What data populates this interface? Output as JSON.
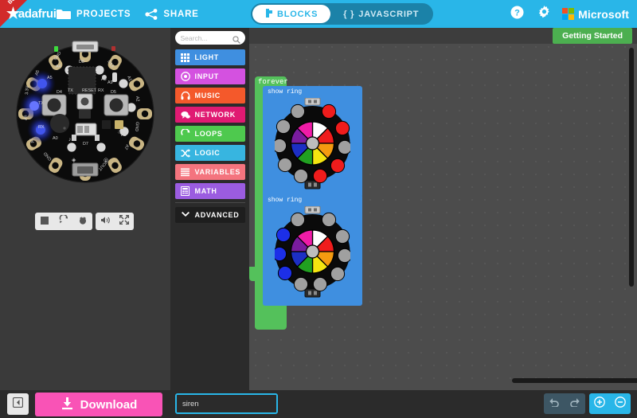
{
  "header": {
    "beta_label": "Beta",
    "brand": "adafruit",
    "brand_icon": "star-icon",
    "menu": [
      {
        "label": "PROJECTS",
        "icon": "folder-icon"
      },
      {
        "label": "SHARE",
        "icon": "share-icon"
      }
    ],
    "modes": [
      {
        "label": "BLOCKS",
        "icon": "blocks-icon",
        "active": true
      },
      {
        "label": "JAVASCRIPT",
        "icon": "braces-icon",
        "active": false
      }
    ],
    "help_icon": "question-circle-icon",
    "settings_icon": "gear-icon",
    "microsoft_label": "Microsoft",
    "microsoft_icon": "microsoft-logo-icon",
    "bg_color": "#29b6e8"
  },
  "getting_started": {
    "label": "Getting Started",
    "color": "#4caf50"
  },
  "simulator": {
    "board_name": "Circuit Playground Express",
    "controls": [
      {
        "name": "stop-button",
        "icon": "stop-square-icon"
      },
      {
        "name": "restart-button",
        "icon": "refresh-icon"
      },
      {
        "name": "debug-button",
        "icon": "bug-icon"
      },
      {
        "name": "mute-button",
        "icon": "speaker-icon"
      },
      {
        "name": "fullscreen-button",
        "icon": "expand-icon"
      }
    ],
    "lit_neopixels": [
      {
        "index": 3,
        "color": "#3b4fe0"
      },
      {
        "index": 4,
        "color": "#6a74f0"
      },
      {
        "index": 5,
        "color": "#3b4fe0"
      }
    ],
    "power_led_color": "#3ddc3d",
    "pin_labels": [
      "GND",
      "3.3V",
      "A5",
      "A4",
      "A7",
      "TX",
      "A6",
      "RX",
      "A1",
      "A2",
      "A3",
      "A9",
      "GND",
      "VOUT",
      "A0",
      "D8",
      "D13",
      "D4",
      "D5",
      "D7",
      "RESET"
    ]
  },
  "toolbox": {
    "search": {
      "placeholder": "Search...",
      "value": "",
      "icon": "search-icon"
    },
    "categories": [
      {
        "label": "LIGHT",
        "color": "#3f8fe0",
        "icon": "grid-icon"
      },
      {
        "label": "INPUT",
        "color": "#d451e0",
        "icon": "target-icon"
      },
      {
        "label": "MUSIC",
        "color": "#f4592b",
        "icon": "headphones-icon"
      },
      {
        "label": "NETWORK",
        "color": "#e01a72",
        "icon": "chat-icon"
      },
      {
        "label": "LOOPS",
        "color": "#4ec94e",
        "icon": "loop-icon"
      },
      {
        "label": "LOGIC",
        "color": "#37b5e0",
        "icon": "shuffle-icon"
      },
      {
        "label": "VARIABLES",
        "color": "#f4747e",
        "icon": "lines-icon"
      },
      {
        "label": "MATH",
        "color": "#9b5ce0",
        "icon": "calculator-icon"
      }
    ],
    "advanced": {
      "label": "ADVANCED",
      "icon": "chevron-down-icon",
      "color": "#1e1e1e"
    }
  },
  "workspace": {
    "blocks": [
      {
        "type": "forever",
        "label": "forever",
        "color": "#54c15b",
        "children": [
          {
            "type": "show_ring",
            "label": "show ring",
            "color": "#3f8fe0",
            "ring": {
              "wheel": [
                "#ffffff",
                "#ef1c1c",
                "#f59b10",
                "#f5e510",
                "#21a021",
                "#1c2fc4",
                "#7a1c9e",
                "#f01ca8"
              ],
              "leds": [
                "#a0a0a0",
                "#a0a0a0",
                "#ef1c1c",
                "#ef1c1c",
                "#a0a0a0",
                "#ef1c1c",
                "#ef1c1c",
                "#a0a0a0",
                "#a0a0a0",
                "#a0a0a0"
              ]
            }
          },
          {
            "type": "show_ring",
            "label": "show ring",
            "color": "#3f8fe0",
            "ring": {
              "wheel": [
                "#ffffff",
                "#ef1c1c",
                "#f59b10",
                "#f5e510",
                "#21a021",
                "#1c2fc4",
                "#7a1c9e",
                "#f01ca8"
              ],
              "leds": [
                "#a0a0a0",
                "#a0a0a0",
                "#a0a0a0",
                "#a0a0a0",
                "#a0a0a0",
                "#a0a0a0",
                "#a0a0a0",
                "#1c2fe8",
                "#1c2fe8",
                "#1c2fe8"
              ]
            }
          }
        ]
      }
    ]
  },
  "footer": {
    "collapse_icon": "collapse-panel-icon",
    "download_label": "Download",
    "download_icon": "download-icon",
    "download_color": "#f953b6",
    "project_name": "siren",
    "project_name_placeholder": "",
    "save_icon": "floppy-save-icon",
    "buttons": [
      {
        "name": "undo-button",
        "icon": "undo-icon"
      },
      {
        "name": "redo-button",
        "icon": "redo-icon"
      },
      {
        "name": "zoom-in-button",
        "icon": "zoom-in-icon"
      },
      {
        "name": "zoom-out-button",
        "icon": "zoom-out-icon"
      }
    ]
  }
}
